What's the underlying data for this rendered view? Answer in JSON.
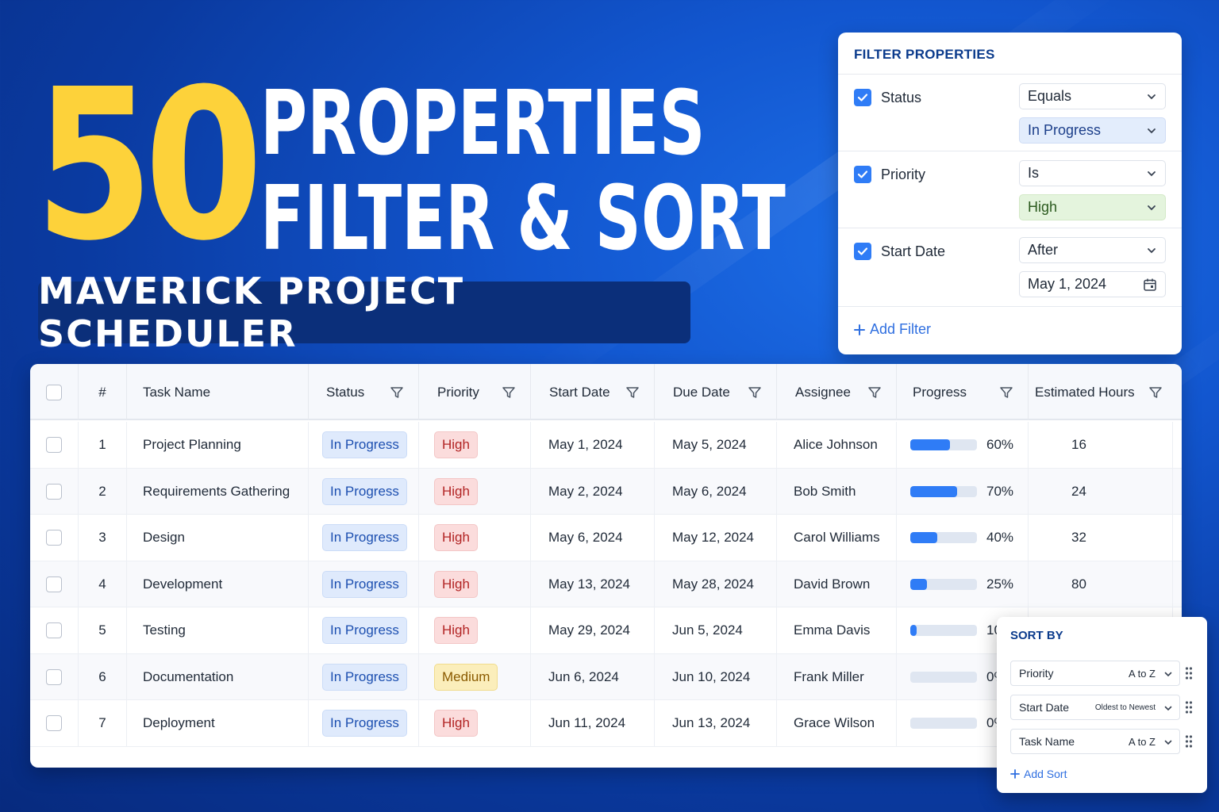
{
  "hero": {
    "number": "50",
    "line1": "PROPERTIES",
    "line2": "FILTER & SORT",
    "brand": "MAVERICK PROJECT SCHEDULER"
  },
  "filter_panel": {
    "title": "FILTER PROPERTIES",
    "filters": [
      {
        "label": "Status",
        "operator": "Equals",
        "value": "In Progress",
        "checked": true
      },
      {
        "label": "Priority",
        "operator": "Is",
        "value": "High",
        "checked": true
      },
      {
        "label": "Start Date",
        "operator": "After",
        "value": "May 1, 2024",
        "checked": true
      }
    ],
    "add_label": "Add Filter"
  },
  "table": {
    "columns": [
      "#",
      "Task Name",
      "Status",
      "Priority",
      "Start Date",
      "Due Date",
      "Assignee",
      "Progress",
      "Estimated Hours"
    ],
    "rows": [
      {
        "num": "1",
        "task": "Project Planning",
        "status": "In Progress",
        "priority": "High",
        "start": "May 1, 2024",
        "due": "May 5, 2024",
        "assignee": "Alice Johnson",
        "progress": 60,
        "progress_label": "60%",
        "hours": "16"
      },
      {
        "num": "2",
        "task": "Requirements Gathering",
        "status": "In Progress",
        "priority": "High",
        "start": "May 2, 2024",
        "due": "May 6, 2024",
        "assignee": "Bob Smith",
        "progress": 70,
        "progress_label": "70%",
        "hours": "24"
      },
      {
        "num": "3",
        "task": "Design",
        "status": "In Progress",
        "priority": "High",
        "start": "May 6, 2024",
        "due": "May 12, 2024",
        "assignee": "Carol Williams",
        "progress": 40,
        "progress_label": "40%",
        "hours": "32"
      },
      {
        "num": "4",
        "task": "Development",
        "status": "In Progress",
        "priority": "High",
        "start": "May 13, 2024",
        "due": "May 28, 2024",
        "assignee": "David Brown",
        "progress": 25,
        "progress_label": "25%",
        "hours": "80"
      },
      {
        "num": "5",
        "task": "Testing",
        "status": "In Progress",
        "priority": "High",
        "start": "May 29, 2024",
        "due": "Jun 5, 2024",
        "assignee": "Emma Davis",
        "progress": 10,
        "progress_label": "10%",
        "hours": ""
      },
      {
        "num": "6",
        "task": "Documentation",
        "status": "In Progress",
        "priority": "Medium",
        "start": "Jun 6, 2024",
        "due": "Jun 10, 2024",
        "assignee": "Frank Miller",
        "progress": 0,
        "progress_label": "0%",
        "hours": ""
      },
      {
        "num": "7",
        "task": "Deployment",
        "status": "In Progress",
        "priority": "High",
        "start": "Jun 11, 2024",
        "due": "Jun 13, 2024",
        "assignee": "Grace Wilson",
        "progress": 0,
        "progress_label": "0%",
        "hours": ""
      }
    ]
  },
  "sort_panel": {
    "title": "SORT BY",
    "items": [
      {
        "field": "Priority",
        "direction": "A to Z"
      },
      {
        "field": "Start Date",
        "direction": "Oldest to Newest"
      },
      {
        "field": "Task Name",
        "direction": "A to Z"
      }
    ],
    "add_label": "Add Sort"
  },
  "colors": {
    "hero_number": "#fdd23a",
    "accent": "#2f7cf6",
    "high": "#b22424",
    "medium": "#8a5a00"
  }
}
